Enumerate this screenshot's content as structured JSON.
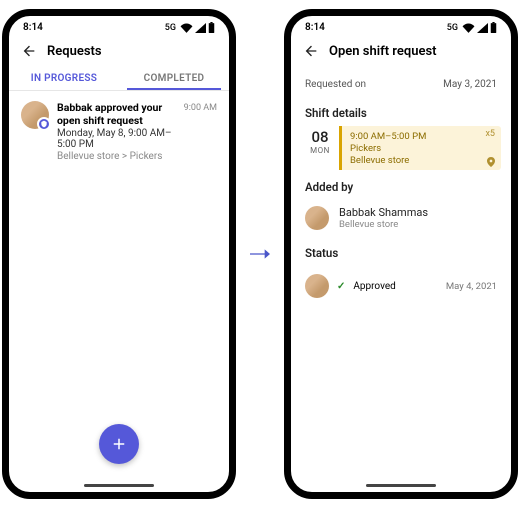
{
  "statusbar": {
    "time": "8:14",
    "net": "5G"
  },
  "left": {
    "title": "Requests",
    "tabs": {
      "in_progress": "IN PROGRESS",
      "completed": "COMPLETED"
    },
    "card": {
      "title": "Babbak approved your open shift request",
      "datetime": "Monday, May 8, 9:00 AM–5:00 PM",
      "crumb": "Bellevue store > Pickers",
      "time": "9:00 AM"
    }
  },
  "right": {
    "title": "Open shift request",
    "requested_label": "Requested on",
    "requested_date": "May 3, 2021",
    "shift_section": "Shift details",
    "shift": {
      "day_num": "08",
      "day_dow": "MON",
      "time": "9:00 AM–5:00 PM",
      "group": "Pickers",
      "store": "Bellevue store",
      "count": "x5"
    },
    "added_section": "Added by",
    "added": {
      "name": "Babbak Shammas",
      "store": "Bellevue store"
    },
    "status_section": "Status",
    "status": {
      "text": "Approved",
      "date": "May 4, 2021"
    }
  }
}
